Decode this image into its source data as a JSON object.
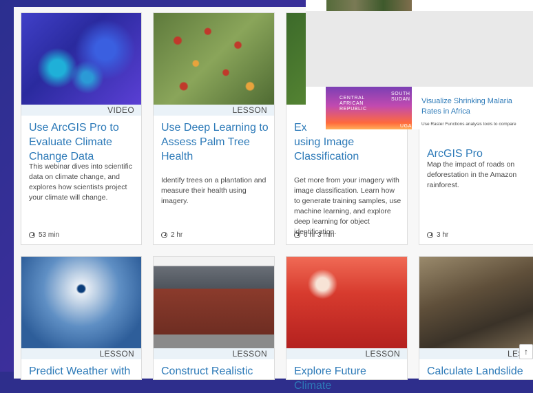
{
  "cards": [
    {
      "badge": "VIDEO",
      "title": "Use ArcGIS Pro to Evaluate Climate Change Data",
      "description": "This webinar dives into scientific data on climate change, and explores how scientists project your climate will change.",
      "duration": "53 min"
    },
    {
      "badge": "LESSON",
      "title": "Use Deep Learning to Assess Palm Tree Health",
      "description": "Identify trees on a plantation and measure their health using imagery.",
      "duration": "2 hr"
    },
    {
      "badge": "",
      "title": "Ex... using Image Classification",
      "title_visible_line1": "Ex",
      "title_visible_rest": "using Image Classification",
      "description": "Get more from your imagery with image classification. Learn how to generate training samples, use machine learning, and explore deep learning for object identification.",
      "duration": "6 hr 3 min"
    },
    {
      "badge": "",
      "title_visible": "ArcGIS Pro",
      "description": "Map the impact of roads on deforestation in the Amazon rainforest.",
      "duration": "3 hr"
    },
    {
      "badge": "LESSON",
      "title": "Predict Weather with"
    },
    {
      "badge": "LESSON",
      "title": "Construct Realistic"
    },
    {
      "badge": "LESSON",
      "title": "Explore Future Climate"
    },
    {
      "badge": "LESS",
      "title": "Calculate Landslide"
    }
  ],
  "overlay": {
    "image_labels": [
      "CENTRAL",
      "AFRICAN",
      "REPUBLIC",
      "SOUTH",
      "SUDAN",
      "UGA"
    ],
    "title": "Visualize Shrinking Malaria Rates in Africa",
    "description": "Use Raster Functions analysis tools to compare"
  },
  "scroll_top_icon": "↑",
  "colors": {
    "title": "#2d7ab8",
    "badge_bg": "#eaf2f8",
    "background": "#2e2e8c"
  }
}
